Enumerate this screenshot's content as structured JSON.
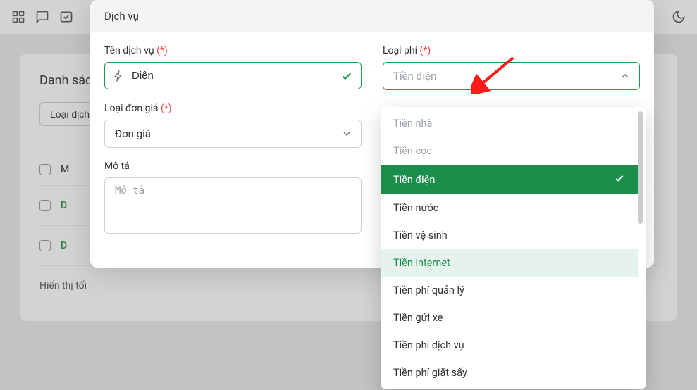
{
  "background": {
    "card_title": "Danh sác",
    "pill_label": "Loại dịch",
    "col_m": "M",
    "row1": "D",
    "row2": "D",
    "footer_text": "Hiển thị tối"
  },
  "modal": {
    "title": "Dịch vụ",
    "service_name_label": "Tên dịch vụ",
    "service_name_value": "Điện",
    "fee_type_label": "Loại phí",
    "fee_type_placeholder": "Tiền điện",
    "unit_price_label": "Loại đơn giá",
    "unit_price_value": "Đơn giá",
    "desc_label": "Mô tả",
    "desc_placeholder": "Mô tả",
    "required_mark": "(*)"
  },
  "dropdown": {
    "items": [
      {
        "label": "Tiền nhà",
        "state": "disabled"
      },
      {
        "label": "Tiền cọc",
        "state": "disabled"
      },
      {
        "label": "Tiền điện",
        "state": "selected"
      },
      {
        "label": "Tiền nước",
        "state": "normal"
      },
      {
        "label": "Tiền vệ sinh",
        "state": "normal"
      },
      {
        "label": "Tiền internet",
        "state": "hover"
      },
      {
        "label": "Tiền phí quản lý",
        "state": "normal"
      },
      {
        "label": "Tiền gửi xe",
        "state": "normal"
      },
      {
        "label": "Tiền phí dịch vụ",
        "state": "normal"
      },
      {
        "label": "Tiền phí giặt sấy",
        "state": "normal"
      }
    ]
  },
  "colors": {
    "accent": "#1a8f4b",
    "danger": "#ef4444"
  }
}
